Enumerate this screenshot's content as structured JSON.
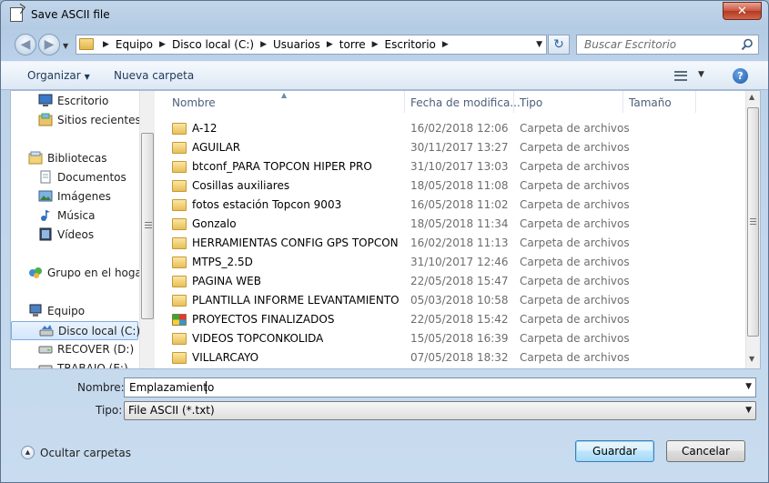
{
  "window": {
    "title": "Save ASCII file",
    "close_label": "✕"
  },
  "address": {
    "crumbs": [
      "Equipo",
      "Disco local (C:)",
      "Usuarios",
      "torre",
      "Escritorio"
    ],
    "search_placeholder": "Buscar Escritorio"
  },
  "toolbar": {
    "organize_label": "Organizar",
    "new_folder_label": "Nueva carpeta",
    "help_label": "?"
  },
  "nav": {
    "items": [
      {
        "label": "Escritorio",
        "icon": "desktop-icon"
      },
      {
        "label": "Sitios recientes",
        "icon": "recent-places-icon"
      },
      {
        "label": "Bibliotecas",
        "icon": "libraries-icon"
      },
      {
        "label": "Documentos",
        "icon": "documents-icon"
      },
      {
        "label": "Imágenes",
        "icon": "pictures-icon"
      },
      {
        "label": "Música",
        "icon": "music-icon"
      },
      {
        "label": "Vídeos",
        "icon": "videos-icon"
      },
      {
        "label": "Grupo en el hogar",
        "icon": "homegroup-icon"
      },
      {
        "label": "Equipo",
        "icon": "computer-icon"
      },
      {
        "label": "Disco local (C:)",
        "icon": "local-disk-icon",
        "selected": true
      },
      {
        "label": "RECOVER (D:)",
        "icon": "drive-icon"
      },
      {
        "label": "TRABAJO (E:)",
        "icon": "drive-icon"
      }
    ]
  },
  "columns": {
    "name": "Nombre",
    "date": "Fecha de modifica...",
    "type": "Tipo",
    "size": "Tamaño"
  },
  "files": [
    {
      "name": "A-12",
      "date": "16/02/2018 12:06",
      "type": "Carpeta de archivos"
    },
    {
      "name": "AGUILAR",
      "date": "30/11/2017 13:27",
      "type": "Carpeta de archivos"
    },
    {
      "name": "btconf_PARA TOPCON HIPER PRO",
      "date": "31/10/2017 13:03",
      "type": "Carpeta de archivos"
    },
    {
      "name": "Cosillas auxiliares",
      "date": "18/05/2018 11:08",
      "type": "Carpeta de archivos"
    },
    {
      "name": "fotos estación Topcon 9003",
      "date": "16/05/2018 11:02",
      "type": "Carpeta de archivos"
    },
    {
      "name": "Gonzalo",
      "date": "18/05/2018 11:34",
      "type": "Carpeta de archivos"
    },
    {
      "name": "HERRAMIENTAS CONFIG GPS TOPCON",
      "date": "16/02/2018 11:13",
      "type": "Carpeta de archivos"
    },
    {
      "name": "MTPS_2.5D",
      "date": "31/10/2017 12:46",
      "type": "Carpeta de archivos"
    },
    {
      "name": "PAGINA WEB",
      "date": "22/05/2018 15:47",
      "type": "Carpeta de archivos"
    },
    {
      "name": "PLANTILLA INFORME LEVANTAMIENTO ...",
      "date": "05/03/2018 10:58",
      "type": "Carpeta de archivos"
    },
    {
      "name": "PROYECTOS FINALIZADOS",
      "date": "22/05/2018 15:42",
      "type": "Carpeta de archivos",
      "special": true
    },
    {
      "name": "VIDEOS TOPCONKOLIDA",
      "date": "15/05/2018 16:39",
      "type": "Carpeta de archivos"
    },
    {
      "name": "VILLARCAYO",
      "date": "07/05/2018 18:32",
      "type": "Carpeta de archivos"
    }
  ],
  "form": {
    "name_label": "Nombre:",
    "name_value": "Emplazamiento",
    "type_label": "Tipo:",
    "type_value": "File ASCII (*.txt)"
  },
  "footer": {
    "hide_folders_label": "Ocultar carpetas",
    "save_label": "Guardar",
    "cancel_label": "Cancelar"
  }
}
